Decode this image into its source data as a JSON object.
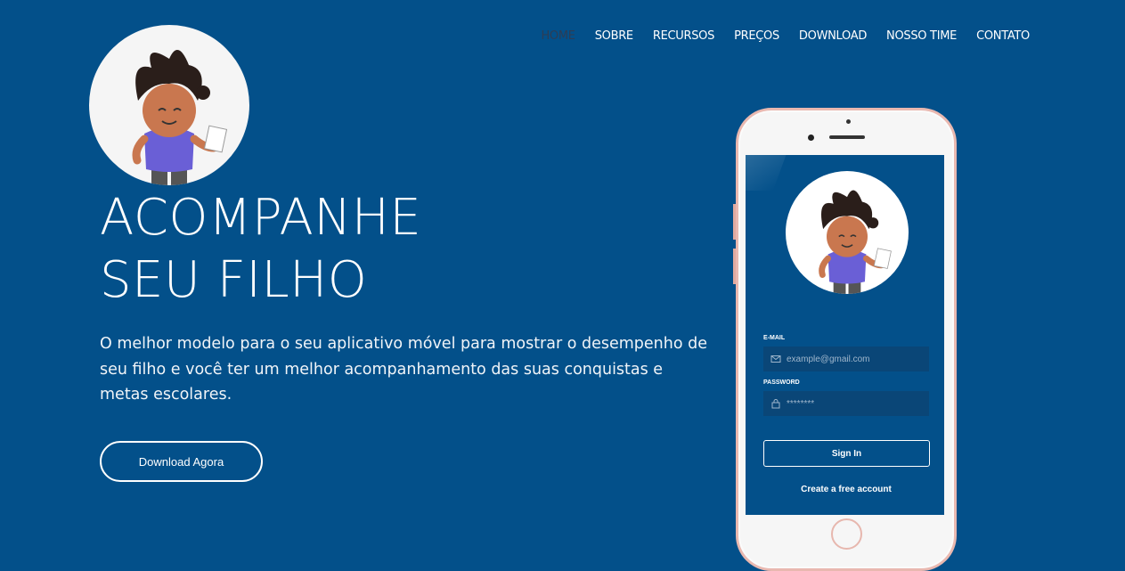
{
  "nav": {
    "items": [
      {
        "label": "HOME",
        "active": true
      },
      {
        "label": "SOBRE",
        "active": false
      },
      {
        "label": "RECURSOS",
        "active": false
      },
      {
        "label": "PREÇOS",
        "active": false
      },
      {
        "label": "DOWNLOAD",
        "active": false
      },
      {
        "label": "NOSSO TIME",
        "active": false
      },
      {
        "label": "CONTATO",
        "active": false
      }
    ]
  },
  "hero": {
    "title_line1": "ACOMPANHE",
    "title_line2": "SEU FILHO",
    "description": "O melhor modelo para o seu aplicativo móvel para mostrar o desempenho de seu filho e você ter um melhor acompanhamento das suas conquistas e metas escolares.",
    "cta_label": "Download Agora"
  },
  "phone": {
    "email_label": "E-MAIL",
    "email_placeholder": "example@gmail.com",
    "password_label": "PASSWORD",
    "password_placeholder": "********",
    "signin_label": "Sign In",
    "create_label": "Create a free account"
  },
  "colors": {
    "background": "#03508a",
    "nav_active": "#2d3d55",
    "phone_frame": "#e9b8b0"
  },
  "icons": {
    "logo": "kid-mascot-icon",
    "email": "mail-icon",
    "password": "lock-icon"
  }
}
